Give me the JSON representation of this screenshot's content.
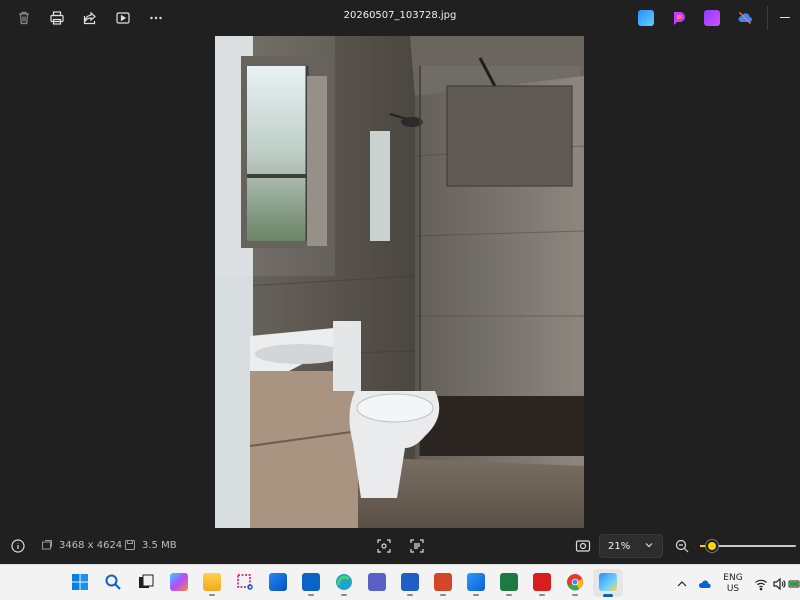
{
  "toolbar": {
    "file_name": "20260507_103728.jpg"
  },
  "info": {
    "dimensions": "3468 x 4624",
    "file_size": "3.5 MB",
    "zoom_level": "21%",
    "zoom_slider_fraction": 0.06
  },
  "tray": {
    "lang_line1": "ENG",
    "lang_line2": "US"
  },
  "colors": {
    "background": "#202020",
    "accent": "#ffd500",
    "taskbar": "#f3f3f3"
  },
  "taskbar_icons": [
    "windows-start-icon",
    "search-icon",
    "task-view-icon",
    "copilot-m365-icon",
    "file-explorer-icon",
    "snipping-tool-icon",
    "outlook-new-icon",
    "outlook-icon",
    "edge-icon",
    "teams-icon",
    "word-icon",
    "powerpoint-icon",
    "people-icon",
    "excel-icon",
    "acrobat-icon",
    "chrome-icon",
    "photos-icon"
  ]
}
